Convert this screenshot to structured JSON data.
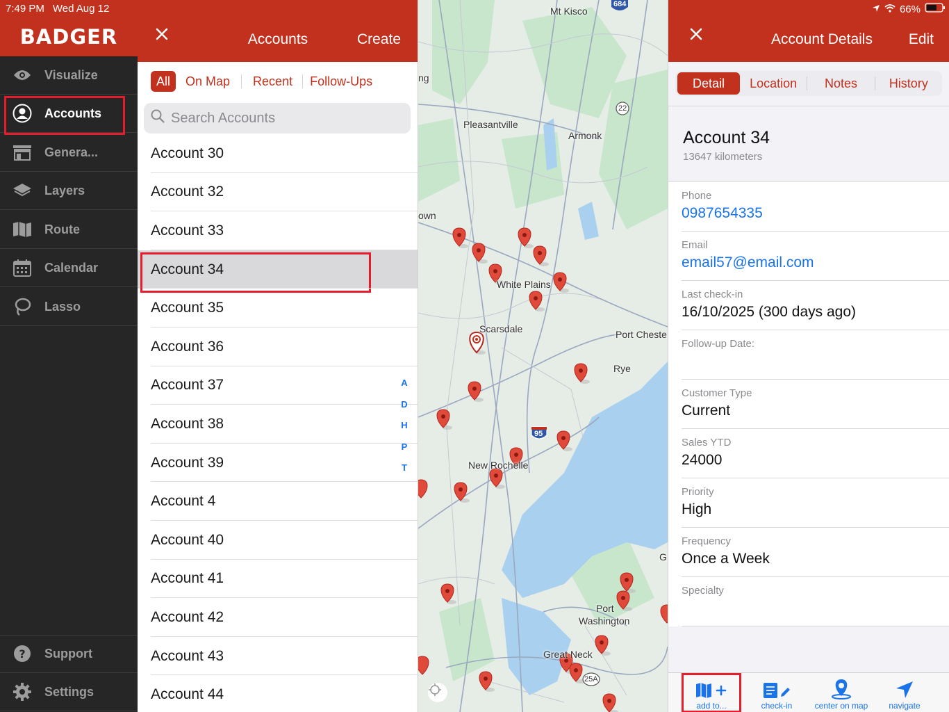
{
  "status_bar": {
    "time": "7:49 PM",
    "date": "Wed Aug 12",
    "battery": "66%"
  },
  "sidebar": {
    "brand": "BADGER",
    "items": [
      {
        "label": "Visualize",
        "icon": "eye-icon"
      },
      {
        "label": "Accounts",
        "icon": "person-circle-icon"
      },
      {
        "label": "Genera...",
        "icon": "storefront-icon"
      },
      {
        "label": "Layers",
        "icon": "layers-icon"
      },
      {
        "label": "Route",
        "icon": "map-route-icon"
      },
      {
        "label": "Calendar",
        "icon": "calendar-icon"
      },
      {
        "label": "Lasso",
        "icon": "lasso-icon"
      }
    ],
    "footer": [
      {
        "label": "Support",
        "icon": "help-icon"
      },
      {
        "label": "Settings",
        "icon": "gear-icon"
      }
    ]
  },
  "accounts_panel": {
    "title": "Accounts",
    "create_label": "Create",
    "filters": [
      "All",
      "On Map",
      "Recent",
      "Follow-Ups"
    ],
    "search_placeholder": "Search Accounts",
    "rows": [
      "Account 30",
      "Account 32",
      "Account 33",
      "Account 34",
      "Account 35",
      "Account 36",
      "Account 37",
      "Account 38",
      "Account 39",
      "Account 4",
      "Account 40",
      "Account 41",
      "Account 42",
      "Account 43",
      "Account 44"
    ],
    "selected": "Account 34",
    "index_letters": [
      "A",
      "D",
      "H",
      "P",
      "T"
    ]
  },
  "map": {
    "labels": [
      "Mt Kisco",
      "684",
      "ng",
      "Pleasantville",
      "22",
      "Armonk",
      "own",
      "White Plains",
      "Scarsdale",
      "Port Cheste",
      "Rye",
      "95",
      "New Rochelle",
      "G",
      "Port",
      "Washington",
      "Great Neck",
      "25A"
    ]
  },
  "details_panel": {
    "title": "Account Details",
    "edit_label": "Edit",
    "tabs": [
      "Detail",
      "Location",
      "Notes",
      "History"
    ],
    "account_name": "Account 34",
    "distance": "13647 kilometers",
    "fields": [
      {
        "label": "Phone",
        "value": "0987654335",
        "link": true
      },
      {
        "label": "Email",
        "value": "email57@email.com",
        "link": true
      },
      {
        "label": "Last check-in",
        "value": "16/10/2025 (300 days ago)",
        "link": false
      },
      {
        "label": "Follow-up Date:",
        "value": "",
        "link": false
      },
      {
        "label": "Customer Type",
        "value": "Current",
        "link": false
      },
      {
        "label": "Sales YTD",
        "value": "24000",
        "link": false
      },
      {
        "label": "Priority",
        "value": "High",
        "link": false
      },
      {
        "label": "Frequency",
        "value": "Once a Week",
        "link": false
      },
      {
        "label": "Specialty",
        "value": "",
        "link": false
      }
    ],
    "toolbar": [
      {
        "label": "add to...",
        "icon": "map-add-icon"
      },
      {
        "label": "check-in",
        "icon": "check-in-icon"
      },
      {
        "label": "center on map",
        "icon": "location-pin-icon"
      },
      {
        "label": "navigate",
        "icon": "navigate-arrow-icon"
      }
    ]
  },
  "colors": {
    "brand_red": "#c2311d",
    "highlight": "#e31d2b",
    "link_blue": "#1a73e8",
    "sidebar_bg": "#262626"
  }
}
